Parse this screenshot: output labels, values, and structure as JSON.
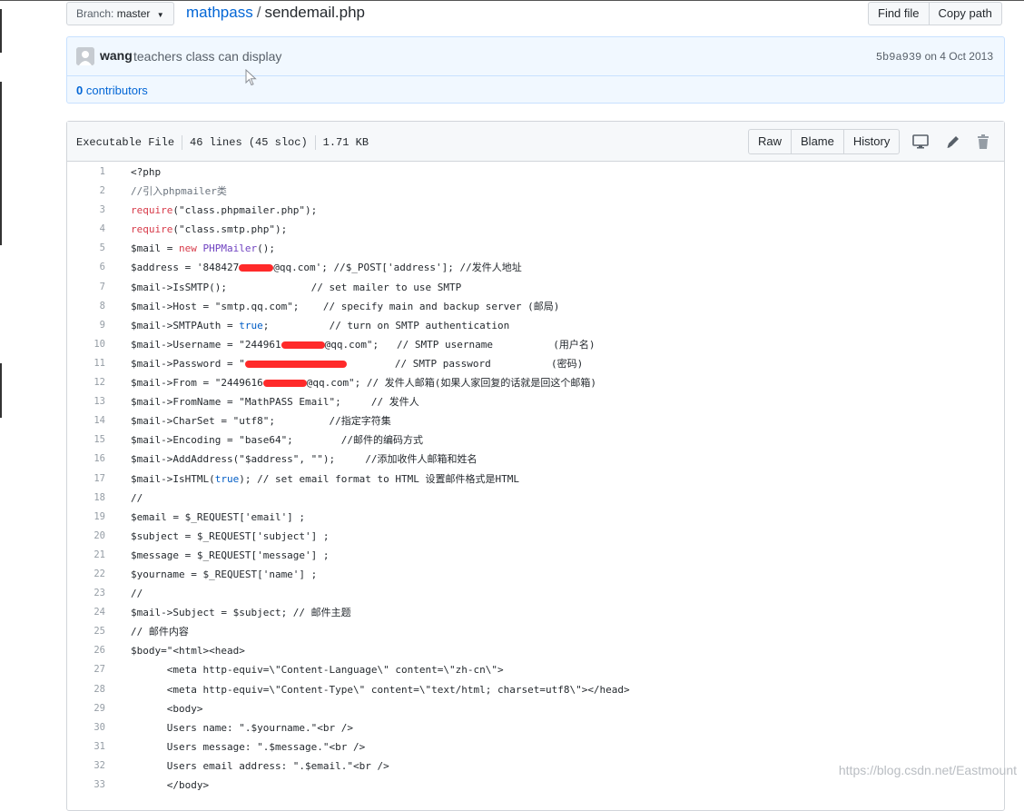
{
  "branch": {
    "label": "Branch:",
    "value": "master"
  },
  "breadcrumb": {
    "repo": "mathpass",
    "separator": "/",
    "file": "sendemail.php"
  },
  "top_buttons": {
    "find_file": "Find file",
    "copy_path": "Copy path"
  },
  "commit": {
    "author": "wang",
    "message": "teachers class can display",
    "sha": "5b9a939",
    "date_text": "on 4 Oct 2013"
  },
  "contributors": {
    "count": "0",
    "label": "contributors"
  },
  "file_info": {
    "type": "Executable File",
    "lines": "46 lines (45 sloc)",
    "size": "1.71 KB"
  },
  "file_buttons": {
    "raw": "Raw",
    "blame": "Blame",
    "history": "History"
  },
  "icons": {
    "desktop": "desktop-icon",
    "edit": "pencil-icon",
    "delete": "trash-icon",
    "cursor": "mouse-cursor-icon",
    "avatar": "avatar-icon"
  },
  "code_lines": [
    {
      "n": "1",
      "t": [
        [
          "",
          "<?php"
        ]
      ]
    },
    {
      "n": "2",
      "t": [
        [
          "com",
          "//引入phpmailer类"
        ]
      ]
    },
    {
      "n": "3",
      "t": [
        [
          "kw",
          "require"
        ],
        [
          "",
          "(\"class.phpmailer.php\");"
        ]
      ]
    },
    {
      "n": "4",
      "t": [
        [
          "kw",
          "require"
        ],
        [
          "",
          "(\"class.smtp.php\");"
        ]
      ]
    },
    {
      "n": "5",
      "t": [
        [
          "",
          "$mail = "
        ],
        [
          "kw",
          "new"
        ],
        [
          "",
          " "
        ],
        [
          "cls",
          "PHPMailer"
        ],
        [
          "",
          "();"
        ]
      ]
    },
    {
      "n": "6",
      "t": [
        [
          "",
          "$address = '848427"
        ],
        [
          "red",
          "38"
        ],
        [
          "",
          "@qq.com'; //$_POST['address']; //发件人地址"
        ]
      ]
    },
    {
      "n": "7",
      "t": [
        [
          "",
          "$mail->IsSMTP();              // set mailer to use SMTP"
        ]
      ]
    },
    {
      "n": "8",
      "t": [
        [
          "",
          "$mail->Host = \"smtp.qq.com\";    // specify main and backup server (邮局)"
        ]
      ]
    },
    {
      "n": "9",
      "t": [
        [
          "",
          "$mail->SMTPAuth = "
        ],
        [
          "con",
          "true"
        ],
        [
          "",
          ";          // turn on SMTP authentication"
        ]
      ]
    },
    {
      "n": "10",
      "t": [
        [
          "",
          "$mail->Username = \"244961"
        ],
        [
          "red",
          "48"
        ],
        [
          "",
          "@qq.com\";   // SMTP username          (用户名)"
        ]
      ]
    },
    {
      "n": "11",
      "t": [
        [
          "",
          "$mail->Password = \""
        ],
        [
          "red",
          "112"
        ],
        [
          "",
          "        // SMTP password          (密码)"
        ]
      ]
    },
    {
      "n": "12",
      "t": [
        [
          "",
          "$mail->From = \"2449616"
        ],
        [
          "red",
          "48"
        ],
        [
          "",
          "@qq.com\"; // 发件人邮箱(如果人家回复的话就是回这个邮箱)"
        ]
      ]
    },
    {
      "n": "13",
      "t": [
        [
          "",
          "$mail->FromName = \"MathPASS Email\";     // 发件人"
        ]
      ]
    },
    {
      "n": "14",
      "t": [
        [
          "",
          "$mail->CharSet = \"utf8\";         //指定字符集"
        ]
      ]
    },
    {
      "n": "15",
      "t": [
        [
          "",
          "$mail->Encoding = \"base64\";        //邮件的编码方式"
        ]
      ]
    },
    {
      "n": "16",
      "t": [
        [
          "",
          "$mail->AddAddress(\"$address\", \"\");     //添加收件人邮箱和姓名"
        ]
      ]
    },
    {
      "n": "17",
      "t": [
        [
          "",
          "$mail->IsHTML("
        ],
        [
          "con",
          "true"
        ],
        [
          "",
          "); // set email format to HTML 设置邮件格式是HTML"
        ]
      ]
    },
    {
      "n": "18",
      "t": [
        [
          "",
          "//"
        ]
      ]
    },
    {
      "n": "19",
      "t": [
        [
          "",
          "$email = $_REQUEST['email'] ;"
        ]
      ]
    },
    {
      "n": "20",
      "t": [
        [
          "",
          "$subject = $_REQUEST['subject'] ;"
        ]
      ]
    },
    {
      "n": "21",
      "t": [
        [
          "",
          "$message = $_REQUEST['message'] ;"
        ]
      ]
    },
    {
      "n": "22",
      "t": [
        [
          "",
          "$yourname = $_REQUEST['name'] ;"
        ]
      ]
    },
    {
      "n": "23",
      "t": [
        [
          "",
          "//"
        ]
      ]
    },
    {
      "n": "24",
      "t": [
        [
          "",
          "$mail->Subject = $subject; // 邮件主题"
        ]
      ]
    },
    {
      "n": "25",
      "t": [
        [
          "",
          "// 邮件内容"
        ]
      ]
    },
    {
      "n": "26",
      "t": [
        [
          "",
          "$body=\"<html><head>"
        ]
      ]
    },
    {
      "n": "27",
      "t": [
        [
          "",
          "      <meta http-equiv=\\\"Content-Language\\\" content=\\\"zh-cn\\\">"
        ]
      ]
    },
    {
      "n": "28",
      "t": [
        [
          "",
          "      <meta http-equiv=\\\"Content-Type\\\" content=\\\"text/html; charset=utf8\\\"></head>"
        ]
      ]
    },
    {
      "n": "29",
      "t": [
        [
          "",
          "      <body>"
        ]
      ]
    },
    {
      "n": "30",
      "t": [
        [
          "",
          "      Users name: \".$yourname.\"<br />"
        ]
      ]
    },
    {
      "n": "31",
      "t": [
        [
          "",
          "      Users message: \".$message.\"<br />"
        ]
      ]
    },
    {
      "n": "32",
      "t": [
        [
          "",
          "      Users email address: \".$email.\"<br />"
        ]
      ]
    },
    {
      "n": "33",
      "t": [
        [
          "",
          "      </body>"
        ]
      ]
    }
  ],
  "watermark": "https://blog.csdn.net/Eastmount"
}
